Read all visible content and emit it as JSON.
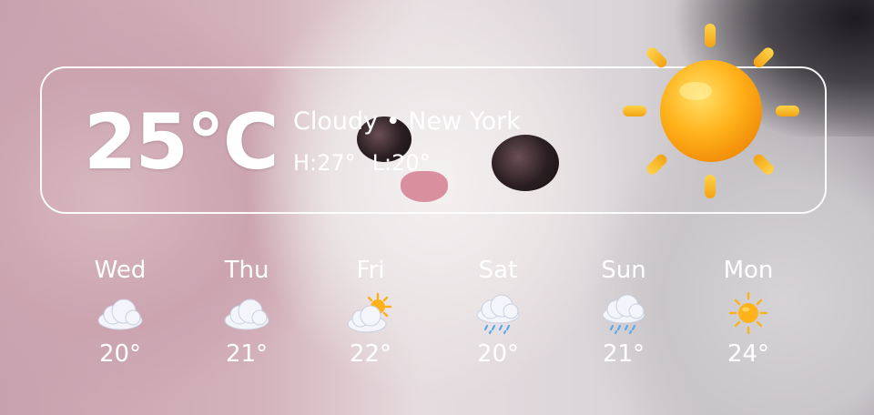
{
  "current": {
    "temperature": "25°C",
    "condition": "Cloudy",
    "separator": "•",
    "city": "New York",
    "high": "H:27°",
    "low": "L:20°",
    "icon": "sun-icon"
  },
  "forecast": [
    {
      "day": "Wed",
      "temp": "20°",
      "icon": "cloud-icon"
    },
    {
      "day": "Thu",
      "temp": "21°",
      "icon": "cloud-icon"
    },
    {
      "day": "Fri",
      "temp": "22°",
      "icon": "sun-behind-cloud-icon"
    },
    {
      "day": "Sat",
      "temp": "20°",
      "icon": "rain-cloud-icon"
    },
    {
      "day": "Sun",
      "temp": "21°",
      "icon": "rain-cloud-icon"
    },
    {
      "day": "Mon",
      "temp": "24°",
      "icon": "sun-icon"
    }
  ],
  "colors": {
    "sun": "#ffb21a",
    "sun_ray": "#f7b21c",
    "cloud": "#f3f5fb",
    "rain": "#5aa9e8",
    "text": "#ffffff"
  }
}
